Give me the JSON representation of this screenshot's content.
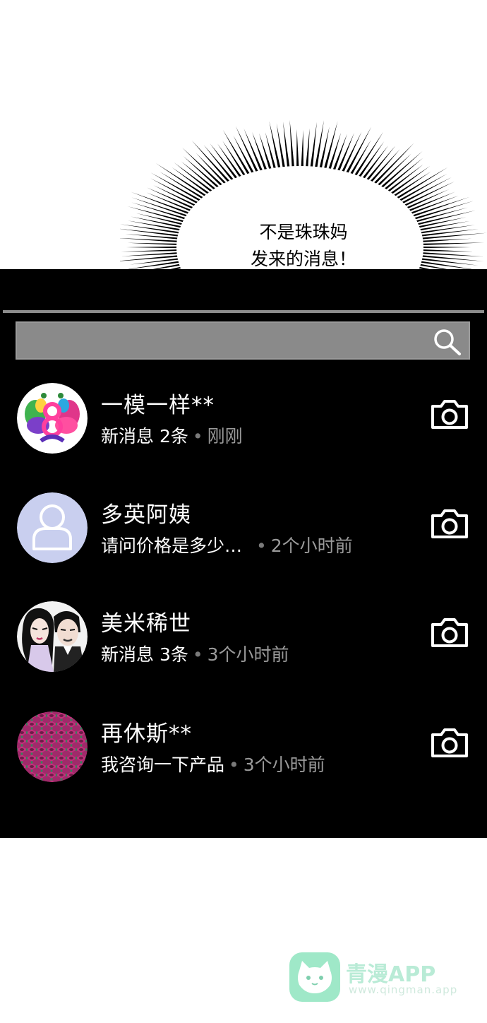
{
  "speech_bubble": {
    "line1": "不是珠珠妈",
    "line2": "发来的消息！"
  },
  "search": {
    "icon": "search-icon"
  },
  "chats": [
    {
      "name": "一模一样**",
      "message": "新消息 2条",
      "separator": "•",
      "time": "刚刚",
      "avatar": "colorful-logo-avatar"
    },
    {
      "name": "多英阿姨",
      "message": "请问价格是多少…",
      "separator": "•",
      "time": "2个小时前",
      "avatar": "default-user-avatar"
    },
    {
      "name": "美米稀世",
      "message": "新消息 3条",
      "separator": "•",
      "time": "3个小时前",
      "avatar": "couple-photo-avatar"
    },
    {
      "name": "再休斯**",
      "message": "我咨询一下产品",
      "separator": "•",
      "time": "3个小时前",
      "avatar": "pattern-avatar"
    }
  ],
  "watermark": {
    "name": "青漫APP",
    "url": "www.qingman.app"
  }
}
